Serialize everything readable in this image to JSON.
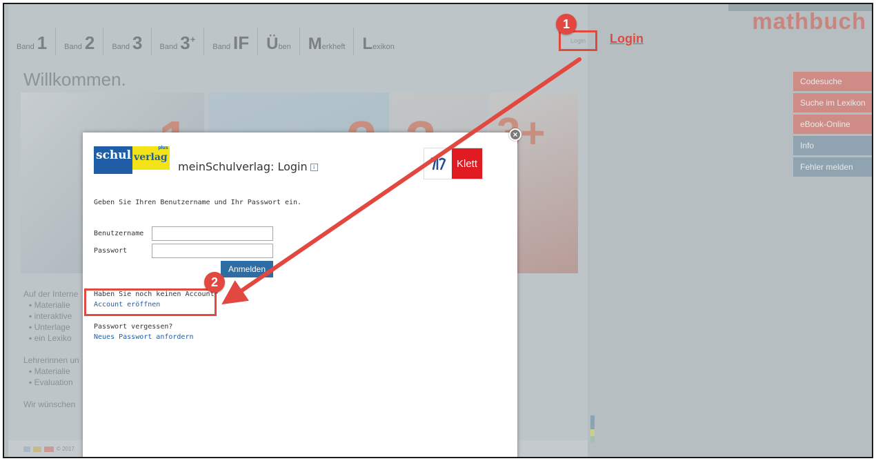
{
  "nav": {
    "items": [
      {
        "small": "Band",
        "big": "1",
        "sup": ""
      },
      {
        "small": "Band",
        "big": "2",
        "sup": ""
      },
      {
        "small": "Band",
        "big": "3",
        "sup": ""
      },
      {
        "small": "Band",
        "big": "3",
        "sup": "+"
      },
      {
        "small": "Band",
        "big": "IF",
        "sup": ""
      }
    ],
    "ueben": {
      "cap": "Ü",
      "tail": "ben"
    },
    "merkheft": {
      "cap": "M",
      "tail": "erkheft"
    },
    "lexikon": {
      "cap": "L",
      "tail": "exikon"
    },
    "login_small": "Login"
  },
  "annotations": {
    "login_label": "Login",
    "badge1": "1",
    "badge2": "2",
    "color": "#e2483f"
  },
  "brand": "mathbuch",
  "side_menu": [
    {
      "label": "Codesuche",
      "tone": "red"
    },
    {
      "label": "Suche im Lexikon",
      "tone": "red"
    },
    {
      "label": "eBook-Online",
      "tone": "red"
    },
    {
      "label": "Info",
      "tone": "blue"
    },
    {
      "label": "Fehler melden",
      "tone": "blue"
    }
  ],
  "page": {
    "welcome": "Willkommen.",
    "banner_numbers": [
      "1",
      "2",
      "3",
      "3+"
    ],
    "body": {
      "para1": "Auf der Interne",
      "list1": [
        "Materialie",
        "interaktive",
        "Unterlage",
        "ein Lexiko"
      ],
      "para2": "Lehrerinnen un",
      "list2": [
        "Materialie",
        "Evaluation"
      ],
      "para3": "Wir wünschen"
    },
    "footer": "© 2017"
  },
  "modal": {
    "logo_left": {
      "part1": "schul",
      "part2": "verlag",
      "plus": "plus"
    },
    "title": "meinSchulverlag: Login",
    "info_icon": "i",
    "logo_right": {
      "mark": "Klett"
    },
    "intro": "Geben Sie Ihren Benutzername und Ihr Passwort ein.",
    "username_label": "Benutzername",
    "password_label": "Passwort",
    "username_value": "",
    "password_value": "",
    "login_button": "Anmelden",
    "no_account_text": "Haben Sie noch keinen Account?",
    "create_account_link": "Account eröffnen",
    "forgot_text": "Passwort vergessen?",
    "new_password_link": "Neues Passwort anfordern",
    "close": "×"
  }
}
